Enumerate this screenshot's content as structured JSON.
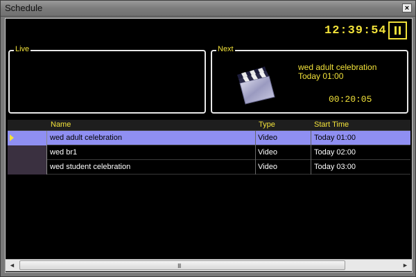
{
  "window": {
    "title": "Schedule",
    "close_label": "×"
  },
  "clock": "12:39:54",
  "live": {
    "label": "Live"
  },
  "next": {
    "label": "Next",
    "name": "wed adult celebration",
    "time": "Today 01:00",
    "countdown": "00:20:05",
    "icon": "clapperboard-icon"
  },
  "table": {
    "columns": [
      "Name",
      "Type",
      "Start Time"
    ],
    "rows": [
      {
        "name": "wed adult celebration",
        "type": "Video",
        "start": "Today 01:00",
        "selected": true
      },
      {
        "name": "wed br1",
        "type": "Video",
        "start": "Today 02:00",
        "selected": false
      },
      {
        "name": "wed student celebration",
        "type": "Video",
        "start": "Today 03:00",
        "selected": false
      }
    ]
  },
  "scrollbar": {
    "left_arrow": "◄",
    "right_arrow": "►",
    "grip": "III"
  },
  "colors": {
    "accent": "#f2e23a",
    "selection": "#8f8ff2",
    "background": "#000000"
  }
}
